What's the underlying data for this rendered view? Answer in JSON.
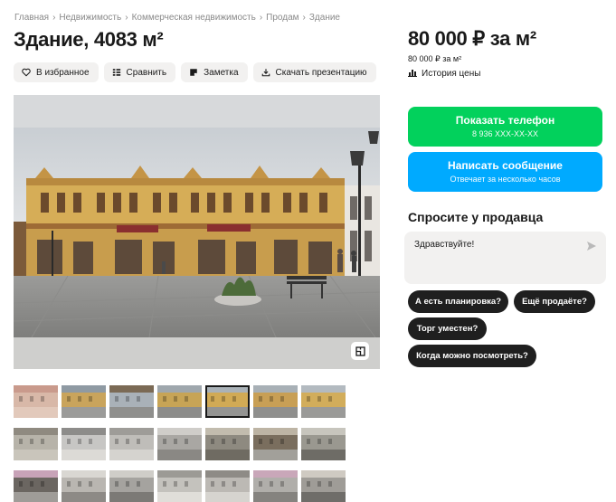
{
  "breadcrumbs": [
    "Главная",
    "Недвижимость",
    "Коммерческая недвижимость",
    "Продам",
    "Здание"
  ],
  "title": "Здание, 4083 м²",
  "actions": {
    "favorite": "В избранное",
    "compare": "Сравнить",
    "note": "Заметка",
    "download": "Скачать презентацию"
  },
  "price": {
    "main": "80 000 ₽ за м²",
    "sub": "80 000 ₽ за м²",
    "history": "История цены"
  },
  "contact": {
    "phone_label": "Показать телефон",
    "phone_number": "8 936 XXX-XX-XX",
    "message_label": "Написать сообщение",
    "message_sub": "Отвечает за несколько часов"
  },
  "ask": {
    "title": "Спросите у продавца",
    "input_value": "Здравствуйте!",
    "chips": [
      "А есть планировка?",
      "Ещё продаёте?",
      "Торг уместен?",
      "Когда можно посмотреть?"
    ]
  },
  "gallery": {
    "active_index": 4,
    "thumb_count": 21
  },
  "colors": {
    "green": "#02d15c",
    "blue": "#00aaff",
    "chip": "#1f1f1f",
    "gray_button": "#f2f1f0"
  },
  "icons": [
    "heart-icon",
    "compare-icon",
    "note-icon",
    "download-icon",
    "chart-icon",
    "send-icon",
    "floor-plan-icon"
  ]
}
